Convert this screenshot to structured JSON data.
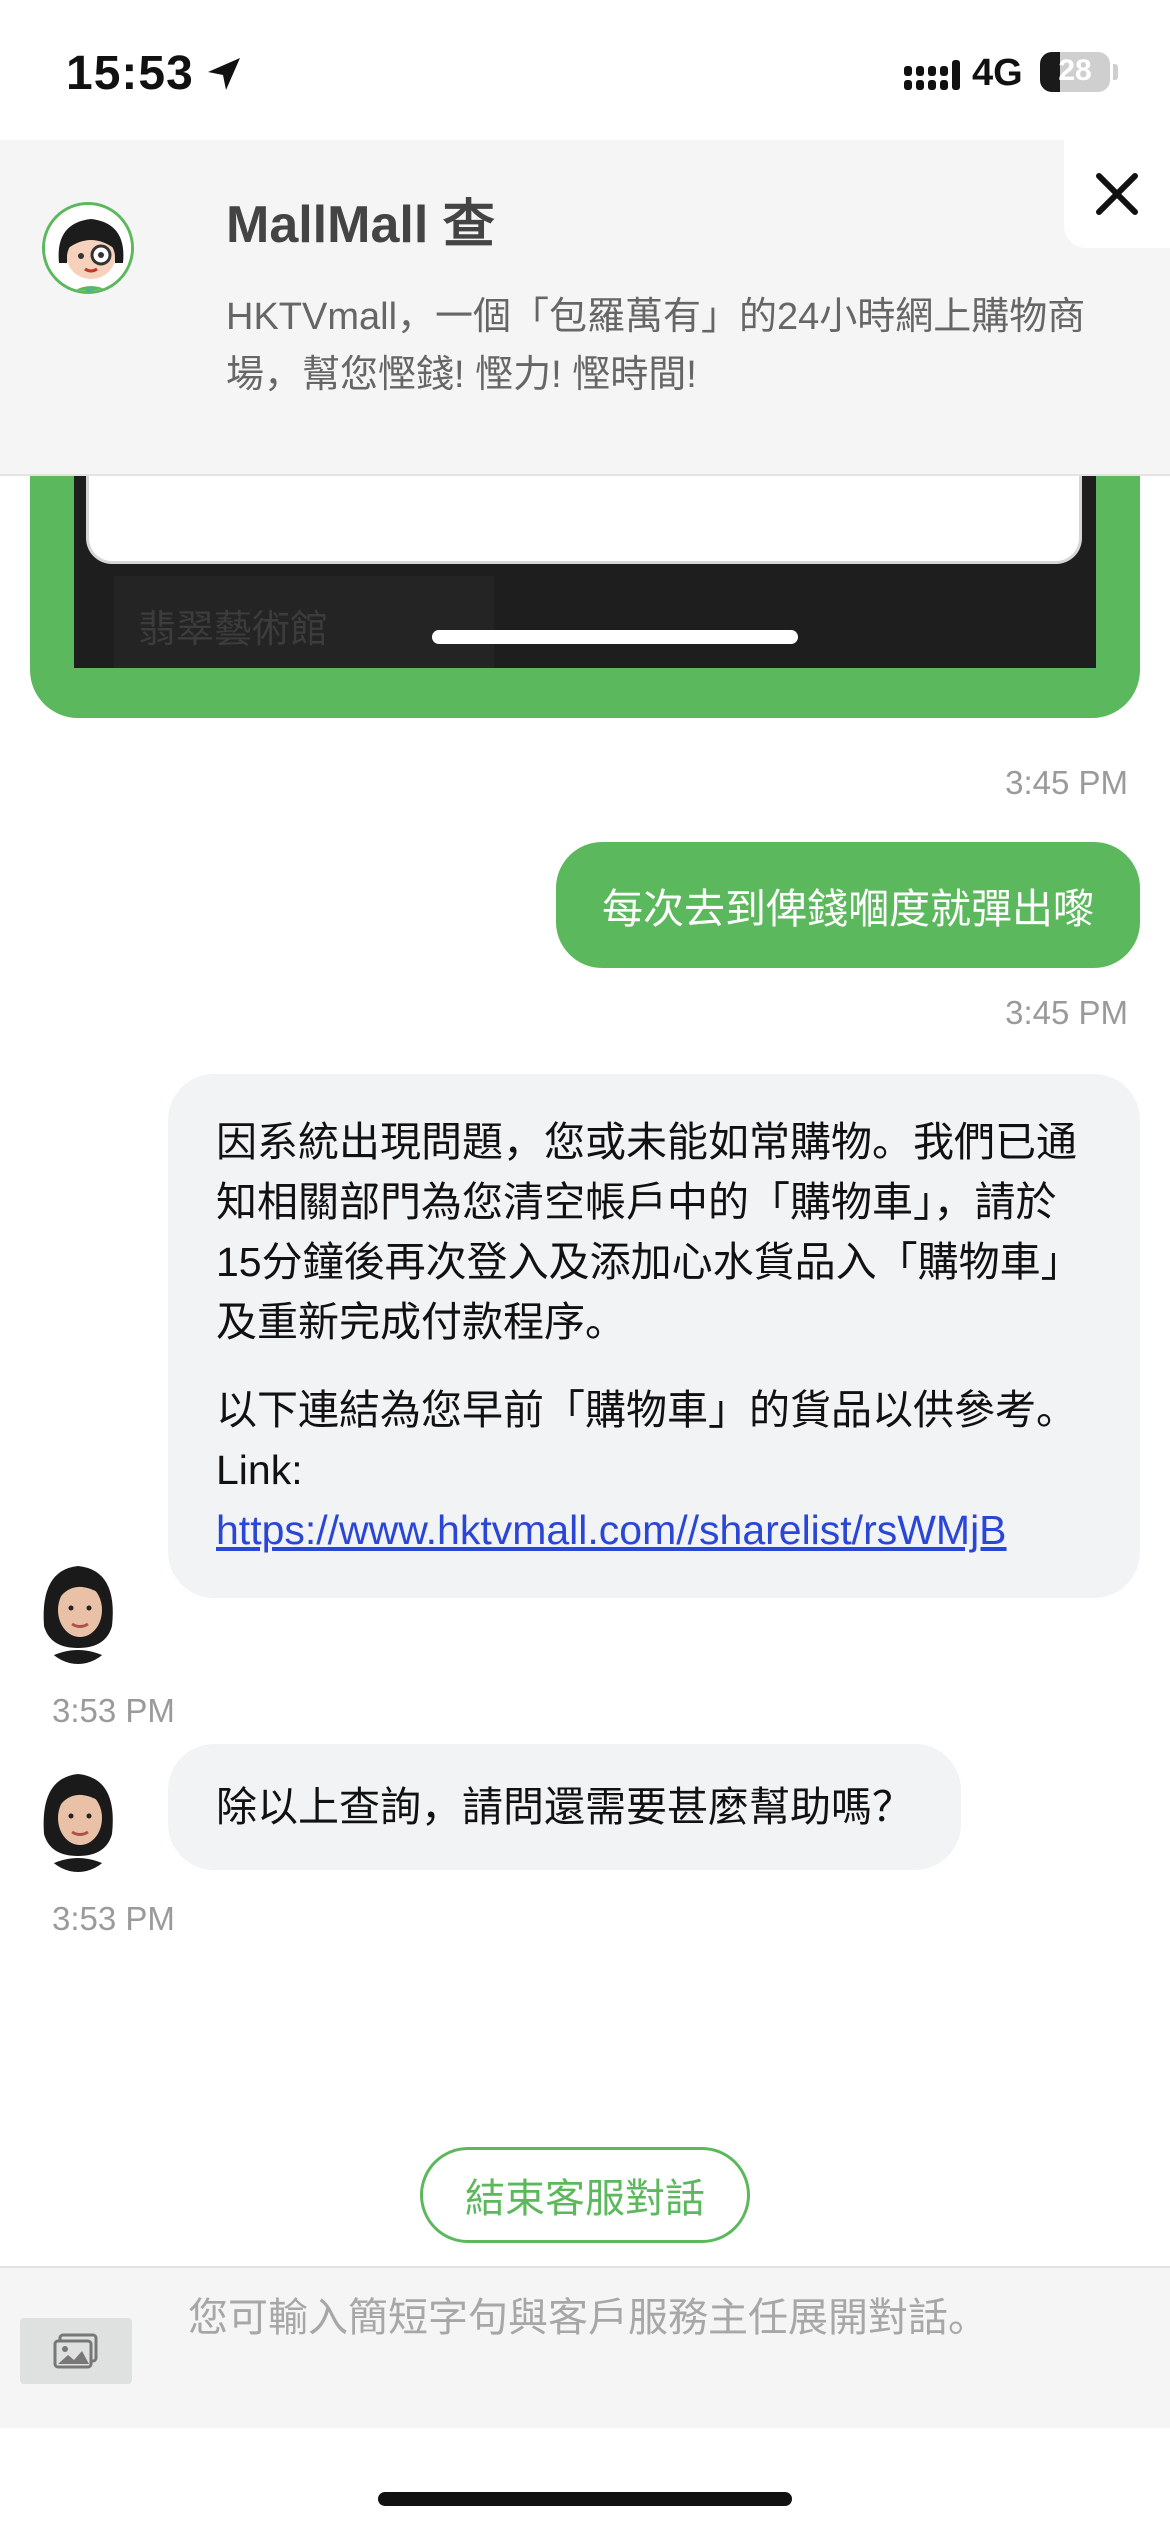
{
  "status_bar": {
    "time": "15:53",
    "network": "4G",
    "battery": "28"
  },
  "header": {
    "title": "MallMall 查",
    "description": "HKTVmall，一個「包羅萬有」的24小時網上購物商場，幫您慳錢! 慳力! 慳時間!"
  },
  "image_message": {
    "label": "翡翠藝術館"
  },
  "messages": {
    "ts_image": "3:45 PM",
    "user_text": "每次去到俾錢嗰度就彈出嚟",
    "ts_user": "3:45 PM",
    "agent1_p1": "因系統出現問題，您或未能如常購物。我們已通知相關部門為您清空帳戶中的「購物車」，請於15分鐘後再次登入及添加心水貨品入「購物車」及重新完成付款程序。",
    "agent1_p2_prefix": "以下連結為您早前「購物車」的貨品以供參考。 Link:",
    "agent1_link": "https://www.hktvmall.com//sharelist/rsWMjB",
    "ts_agent1": "3:53 PM",
    "agent2_text": "除以上查詢，請問還需要甚麼幫助嗎？",
    "ts_agent2": "3:53 PM"
  },
  "end_chat_label": "結束客服對話",
  "input": {
    "placeholder": "您可輸入簡短字句與客戶服務主任展開對話。"
  },
  "icons": {
    "location": "location-arrow-icon",
    "signal": "signal-icon",
    "battery": "battery-icon",
    "close": "close-icon",
    "attach": "image-attach-icon"
  },
  "colors": {
    "brand_green": "#5cb85c",
    "link_blue": "#2a46d6",
    "bubble_grey": "#f2f3f5"
  }
}
